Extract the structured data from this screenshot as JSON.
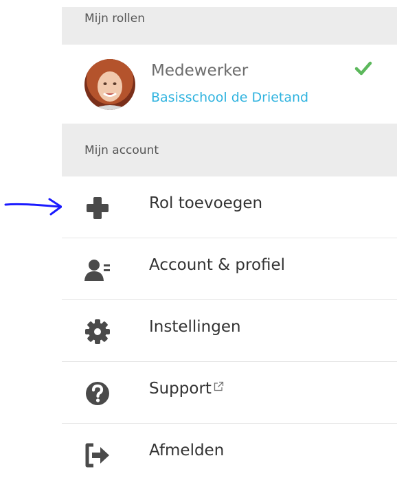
{
  "roles_header": "Mijn rollen",
  "role": {
    "title": "Medewerker",
    "school": "Basisschool de Drietand",
    "active_icon": "check-icon"
  },
  "account_header": "Mijn account",
  "menu": [
    {
      "label": "Rol toevoegen",
      "icon": "plus-icon"
    },
    {
      "label": "Account & profiel",
      "icon": "user-profile-icon"
    },
    {
      "label": "Instellingen",
      "icon": "gear-icon"
    },
    {
      "label": "Support",
      "icon": "question-circle-icon",
      "external": true
    },
    {
      "label": "Afmelden",
      "icon": "logout-icon"
    }
  ],
  "colors": {
    "header_bg": "#ececec",
    "school_link": "#2fb3df",
    "check": "#5cb85c",
    "icon": "#4a4a4a",
    "annotation_arrow": "#1a1aff"
  }
}
